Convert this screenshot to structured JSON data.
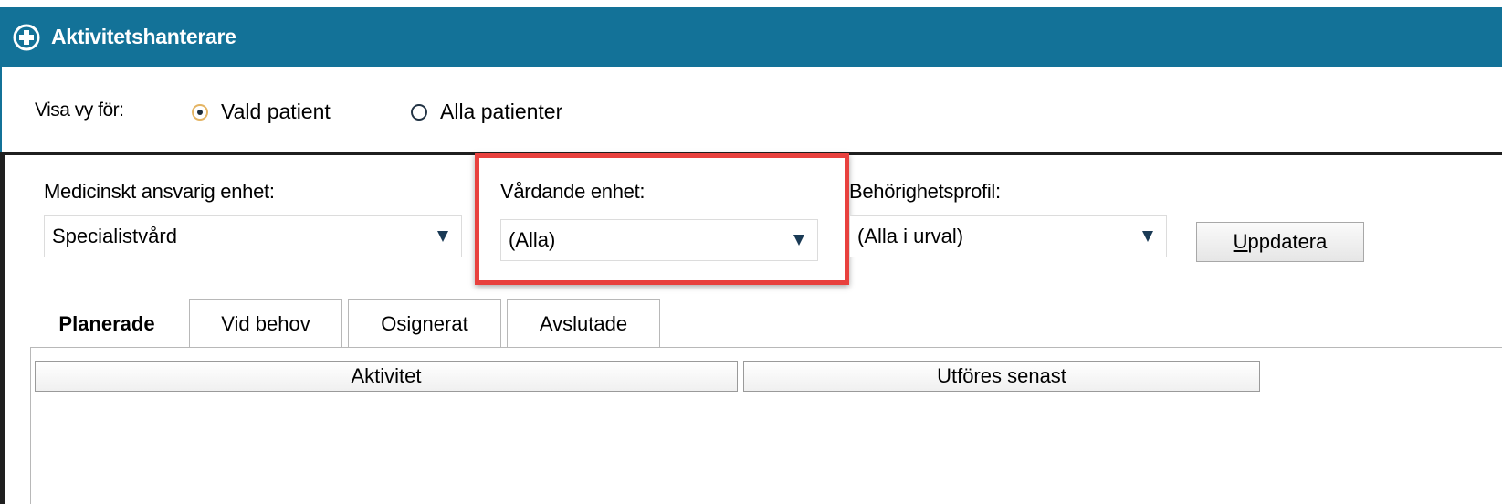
{
  "window": {
    "title": "Aktivitetshanterare",
    "title_icon": "plus-circle-icon"
  },
  "view": {
    "label": "Visa vy för:",
    "options": [
      {
        "label": "Vald patient",
        "checked": true
      },
      {
        "label": "Alla patienter",
        "checked": false
      }
    ]
  },
  "filters": {
    "medical_unit": {
      "label": "Medicinskt ansvarig enhet:",
      "value": "Specialistvård"
    },
    "care_unit": {
      "label": "Vårdande enhet:",
      "value": "(Alla)"
    },
    "profile": {
      "label": "Behörighetsprofil:",
      "value": "(Alla i urval)"
    },
    "update_button": {
      "underlined": "U",
      "rest": "ppdatera"
    }
  },
  "tabs": [
    {
      "label": "Planerade",
      "active": true
    },
    {
      "label": "Vid behov",
      "active": false
    },
    {
      "label": "Osignerat",
      "active": false
    },
    {
      "label": "Avslutade",
      "active": false
    }
  ],
  "table": {
    "columns": [
      "Aktivitet",
      "Utföres senast"
    ]
  },
  "colors": {
    "titlebar": "#137298",
    "highlight": "#e8413e"
  }
}
